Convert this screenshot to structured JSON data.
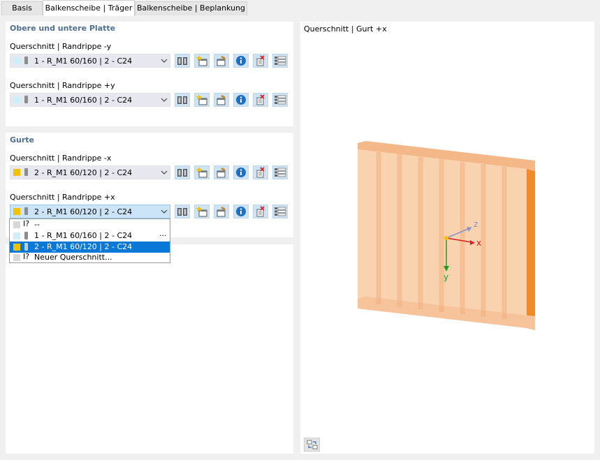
{
  "tabs": [
    {
      "label": "Basis",
      "active": false
    },
    {
      "label": "Balkenscheibe | Träger",
      "active": true
    },
    {
      "label": "Balkenscheibe | Beplankung",
      "active": false
    }
  ],
  "groups": {
    "plate": {
      "title": "Obere und untere Platte",
      "rows": [
        {
          "label": "Querschnitt | Randrippe -y",
          "value": "1 - R_M1 60/160 | 2 - C24",
          "swatch": "#cfeff8"
        },
        {
          "label": "Querschnitt | Randrippe +y",
          "value": "1 - R_M1 60/160 | 2 - C24",
          "swatch": "#cfeff8"
        }
      ]
    },
    "gurte": {
      "title": "Gurte",
      "rows": [
        {
          "label": "Querschnitt | Randrippe -x",
          "value": "2 - R_M1 60/120 | 2 - C24",
          "swatch": "#f2c200"
        },
        {
          "label": "Querschnitt | Randrippe +x",
          "value": "2 - R_M1 60/120 | 2 - C24",
          "swatch": "#f2c200"
        }
      ]
    }
  },
  "dropdown": {
    "items": [
      {
        "text": "--",
        "kind": "undefined"
      },
      {
        "text": "1 - R_M1 60/160 | 2 - C24",
        "kind": "section",
        "swatch": "#cfeff8",
        "extra": "..."
      },
      {
        "text": "2 - R_M1 60/120 | 2 - C24",
        "kind": "section",
        "swatch": "#f2c200",
        "selected": true
      },
      {
        "text": "Neuer Querschnitt...",
        "kind": "new"
      }
    ]
  },
  "preview": {
    "title": "Querschnitt | Gurt +x",
    "axes": {
      "x": "x",
      "y": "y",
      "z": "z"
    }
  },
  "toolbar_icons": [
    "library-icon",
    "new-section-icon",
    "edit-section-icon",
    "info-icon",
    "delete-unused-icon",
    "list-icon"
  ],
  "colors": {
    "accent": "#0a78d7",
    "panel_title": "#4f6f8f",
    "beam": "#f7c9a2",
    "beam_edge": "#f08a2a"
  }
}
